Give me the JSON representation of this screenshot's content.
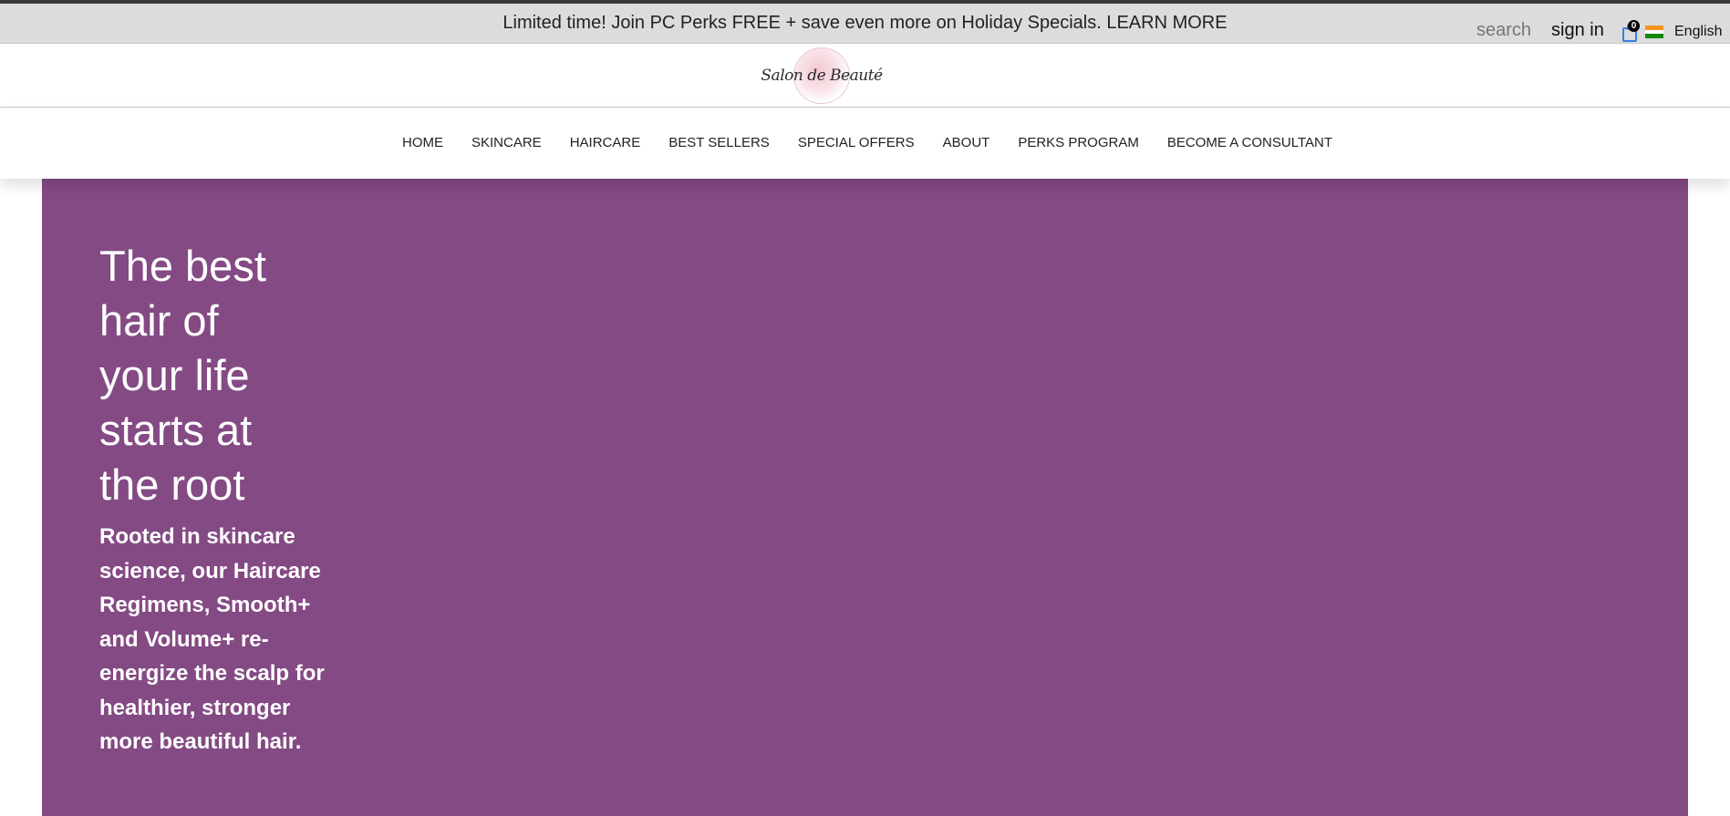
{
  "promo": {
    "text": "Limited time! Join PC Perks FREE + save even more on Holiday Specials. LEARN MORE"
  },
  "header": {
    "logo_text": "Salon de Beauté",
    "search_label": "search",
    "signin_label": "sign in",
    "cart_count": "0",
    "language": "English",
    "flag_colors": [
      "#f7941d",
      "#ffffff",
      "#128807"
    ]
  },
  "nav": {
    "items": [
      {
        "label": "HOME"
      },
      {
        "label": "SKINCARE"
      },
      {
        "label": "HAIRCARE"
      },
      {
        "label": "BEST SELLERS"
      },
      {
        "label": "SPECIAL OFFERS"
      },
      {
        "label": "ABOUT"
      },
      {
        "label": "PERKS PROGRAM"
      },
      {
        "label": "BECOME A CONSULTANT"
      }
    ]
  },
  "hero": {
    "background_color": "#844a84",
    "title": "The best hair of your life starts at the root",
    "subtitle": "Rooted in skincare science, our Haircare Regimens, Smooth+ and Volume+ re-energize the scalp for healthier, stronger more beautiful hair."
  }
}
